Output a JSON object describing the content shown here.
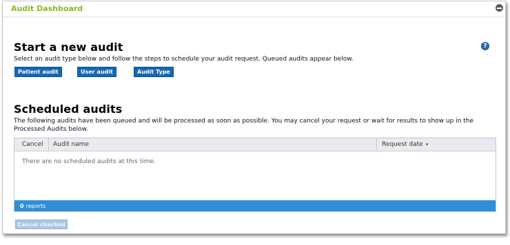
{
  "panel": {
    "title": "Audit Dashboard"
  },
  "start_audit": {
    "heading": "Start a new audit",
    "description": "Select an audit type below and follow the steps to schedule your audit request. Queued audits appear below.",
    "help_label": "?",
    "buttons": {
      "patient": "Patient audit",
      "user": "User audit",
      "type": "Audit Type"
    }
  },
  "scheduled": {
    "heading": "Scheduled audits",
    "description": "The following audits have been queued and will be processed as soon as possible. You may cancel your request or wait for results to show up in the Processed Audits below.",
    "columns": {
      "cancel": "Cancel",
      "name": "Audit name",
      "date": "Request date"
    },
    "sort_indicator": "▾",
    "empty_message": "There are no scheduled audits at this time.",
    "footer_count": "0",
    "footer_label": "reports",
    "cancel_checked_label": "Cancel checked"
  },
  "colors": {
    "title_green": "#8cb626",
    "button_blue": "#1566b5",
    "footer_blue": "#2e8fd8",
    "disabled_button": "#a9c6e3"
  }
}
